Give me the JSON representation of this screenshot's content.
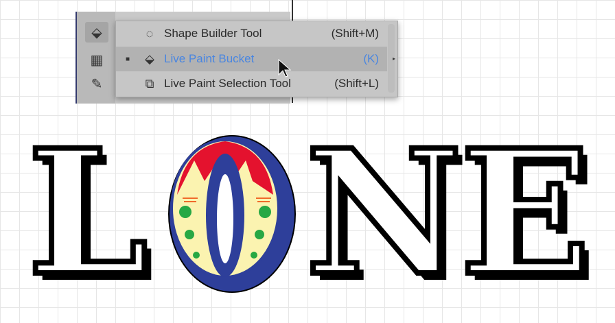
{
  "menu": {
    "items": [
      {
        "label": "Shape Builder Tool",
        "shortcut": "(Shift+M)",
        "icon": "shape-builder-icon",
        "active": false
      },
      {
        "label": "Live Paint Bucket",
        "shortcut": "(K)",
        "icon": "live-paint-bucket-icon",
        "active": true
      },
      {
        "label": "Live Paint Selection Tool",
        "shortcut": "(Shift+L)",
        "icon": "live-paint-selection-icon",
        "active": false
      }
    ]
  },
  "artwork": {
    "letters": [
      "L",
      "O",
      "N",
      "E"
    ],
    "colors": {
      "blue": "#2e3f9a",
      "red": "#e4122e",
      "cream": "#fbf3b0",
      "green": "#27a844",
      "orange": "#f06a2a"
    }
  }
}
